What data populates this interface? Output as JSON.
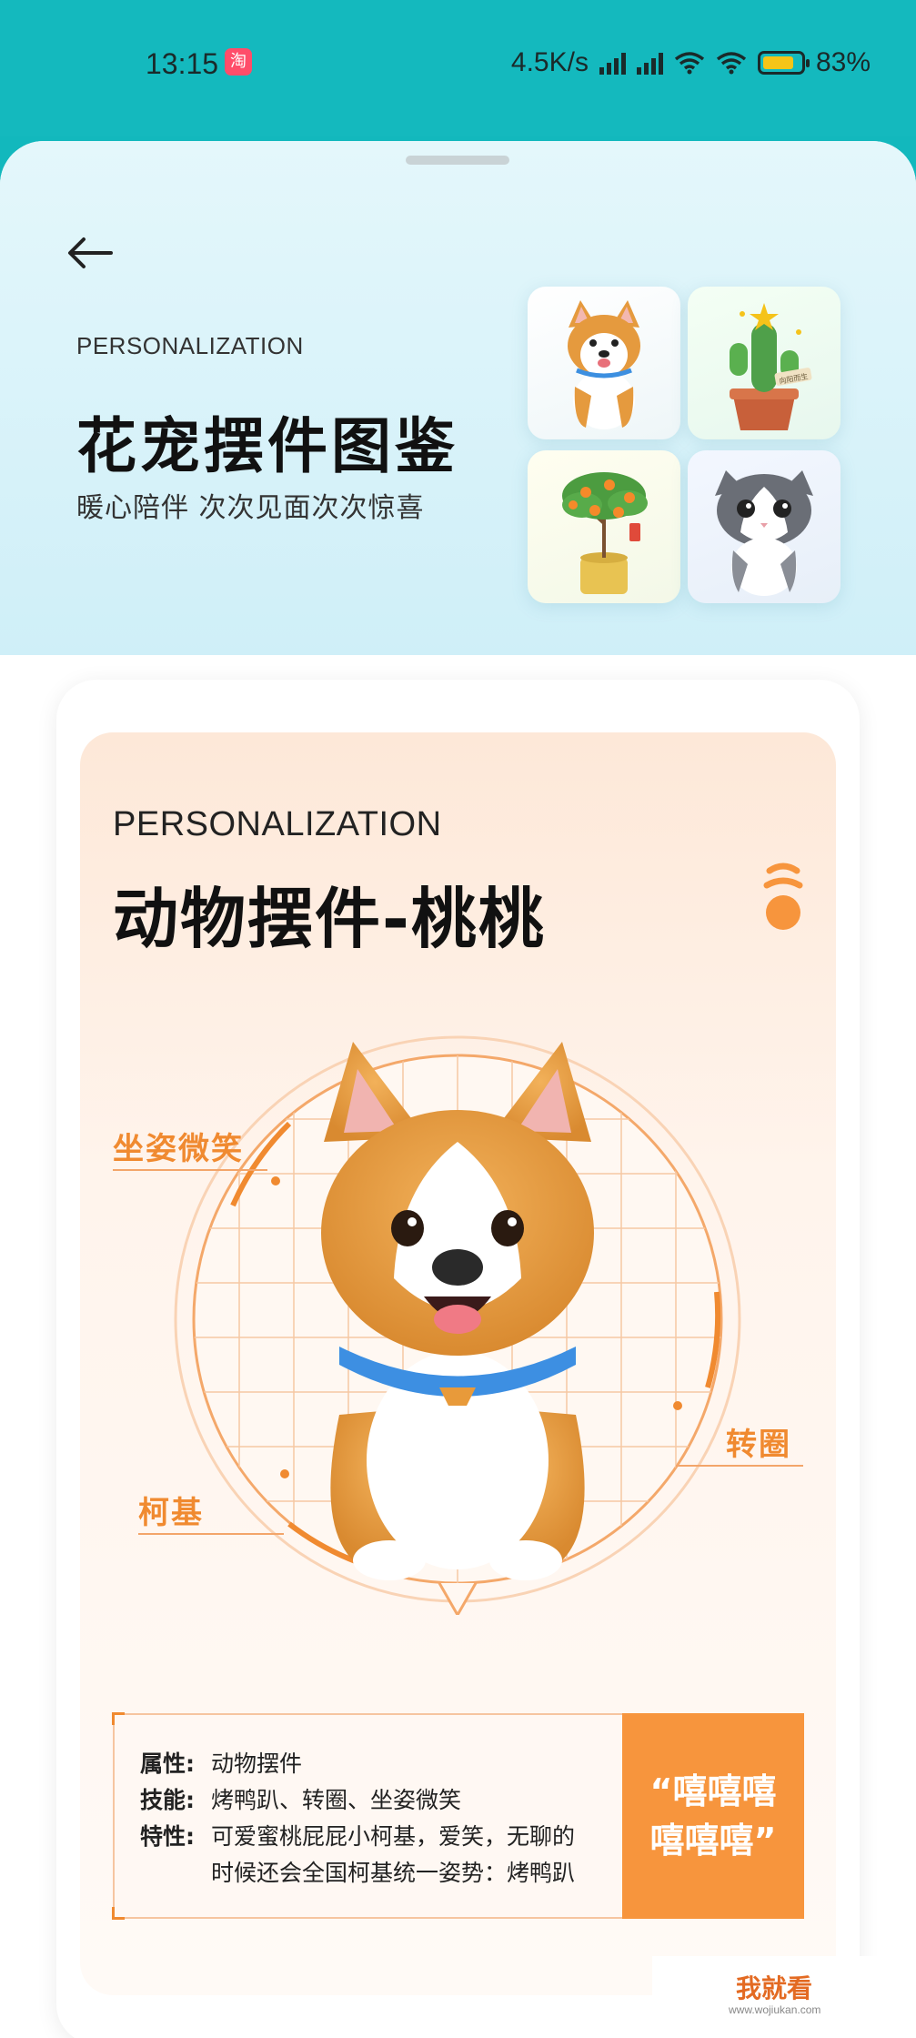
{
  "status_bar": {
    "time": "13:15",
    "app_badge": "淘",
    "speed": "4.5K/s",
    "battery_pct": "83%",
    "battery_level": 0.83
  },
  "header": {
    "eyebrow": "PERSONALIZATION",
    "title": "花宠摆件图鉴",
    "subtitle": "暖心陪伴 次次见面次次惊喜",
    "thumbnails": [
      {
        "name": "corgi"
      },
      {
        "name": "cactus",
        "sign": "向阳而生"
      },
      {
        "name": "persimmon-tree"
      },
      {
        "name": "cat"
      }
    ]
  },
  "card": {
    "eyebrow": "PERSONALIZATION",
    "title": "动物摆件-桃桃",
    "tags": {
      "pose": "坐姿微笑",
      "spin": "转圈",
      "breed": "柯基"
    },
    "info": {
      "rows": [
        {
          "key": "属性:",
          "value": "动物摆件"
        },
        {
          "key": "技能:",
          "value": "烤鸭趴、转圈、坐姿微笑"
        },
        {
          "key": "特性:",
          "value": "可爱蜜桃屁屁小柯基，爱笑，无聊的时候还会全国柯基统一姿势：烤鸭趴"
        }
      ],
      "quote_line1": "“嘻嘻嘻",
      "quote_line2": "嘻嘻嘻”"
    },
    "accent_color": "#f7953d"
  },
  "watermark": {
    "text": "我就看",
    "url": "www.wojiukan.com"
  }
}
